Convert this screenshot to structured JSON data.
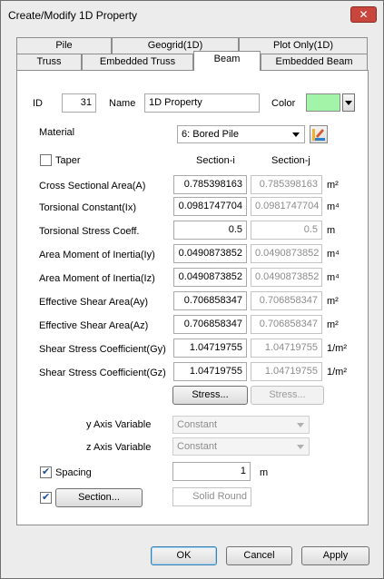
{
  "window": {
    "title": "Create/Modify 1D Property",
    "close_glyph": "✕"
  },
  "tabs": {
    "row1": [
      "Pile",
      "Geogrid(1D)",
      "Plot Only(1D)"
    ],
    "row2": [
      "Truss",
      "Embedded Truss",
      "Beam",
      "Embedded Beam"
    ],
    "active": "Beam"
  },
  "header": {
    "id_label": "ID",
    "id_value": "31",
    "name_label": "Name",
    "name_value": "1D Property",
    "color_label": "Color",
    "color_value": "#a3f4a9"
  },
  "material": {
    "label": "Material",
    "selected": "6: Bored Pile"
  },
  "taper": {
    "label": "Taper",
    "checked": false
  },
  "columns": {
    "section_i": "Section-i",
    "section_j": "Section-j"
  },
  "properties": [
    {
      "label": "Cross Sectional Area(A)",
      "i": "0.785398163",
      "j": "0.785398163",
      "unit": "m²"
    },
    {
      "label": "Torsional Constant(Ix)",
      "i": "0.0981747704",
      "j": "0.0981747704",
      "unit": "m⁴"
    },
    {
      "label": "Torsional Stress Coeff.",
      "i": "0.5",
      "j": "0.5",
      "unit": "m"
    },
    {
      "label": "Area Moment of Inertia(Iy)",
      "i": "0.0490873852",
      "j": "0.0490873852",
      "unit": "m⁴"
    },
    {
      "label": "Area Moment of Inertia(Iz)",
      "i": "0.0490873852",
      "j": "0.0490873852",
      "unit": "m⁴"
    },
    {
      "label": "Effective Shear Area(Ay)",
      "i": "0.706858347",
      "j": "0.706858347",
      "unit": "m²"
    },
    {
      "label": "Effective Shear Area(Az)",
      "i": "0.706858347",
      "j": "0.706858347",
      "unit": "m²"
    },
    {
      "label": "Shear Stress Coefficient(Gy)",
      "i": "1.04719755",
      "j": "1.04719755",
      "unit": "1/m²"
    },
    {
      "label": "Shear Stress Coefficient(Gz)",
      "i": "1.04719755",
      "j": "1.04719755",
      "unit": "1/m²"
    }
  ],
  "stress": {
    "i_label": "Stress...",
    "j_label": "Stress..."
  },
  "y_axis": {
    "label": "y Axis Variable",
    "value": "Constant"
  },
  "z_axis": {
    "label": "z Axis Variable",
    "value": "Constant"
  },
  "spacing": {
    "label": "Spacing",
    "checked": true,
    "value": "1",
    "unit": "m"
  },
  "section": {
    "checked": true,
    "button_label": "Section...",
    "shape": "Solid Round"
  },
  "footer": {
    "ok": "OK",
    "cancel": "Cancel",
    "apply": "Apply"
  }
}
